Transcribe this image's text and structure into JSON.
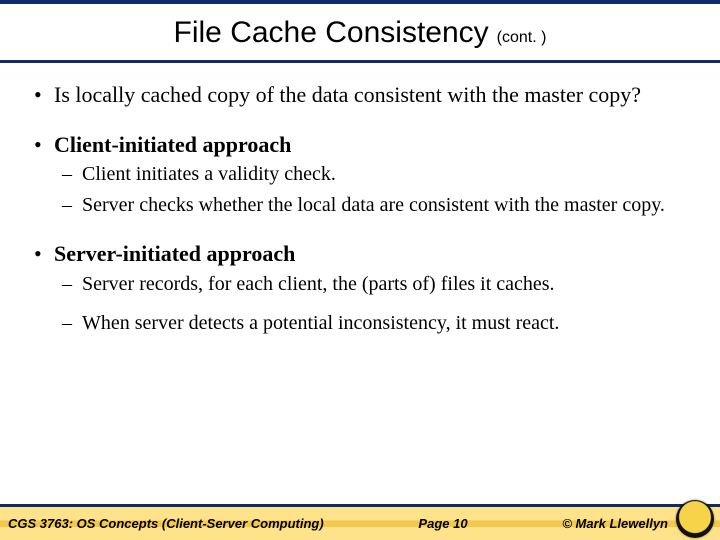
{
  "title": "File Cache Consistency",
  "title_cont": "(cont. )",
  "bullets": {
    "b1": "Is locally cached copy of the data consistent with the master copy?",
    "b2": "Client-initiated approach",
    "b2s1": "Client initiates a validity check.",
    "b2s2": "Server checks whether the local data are consistent with the master copy.",
    "b3": "Server-initiated approach",
    "b3s1": "Server records, for each client, the (parts of) files it caches.",
    "b3s2": "When server detects a potential inconsistency, it must react."
  },
  "footer": {
    "course": "CGS 3763: OS Concepts  (Client-Server Computing)",
    "page": "Page 10",
    "copyright": "© Mark Llewellyn"
  }
}
